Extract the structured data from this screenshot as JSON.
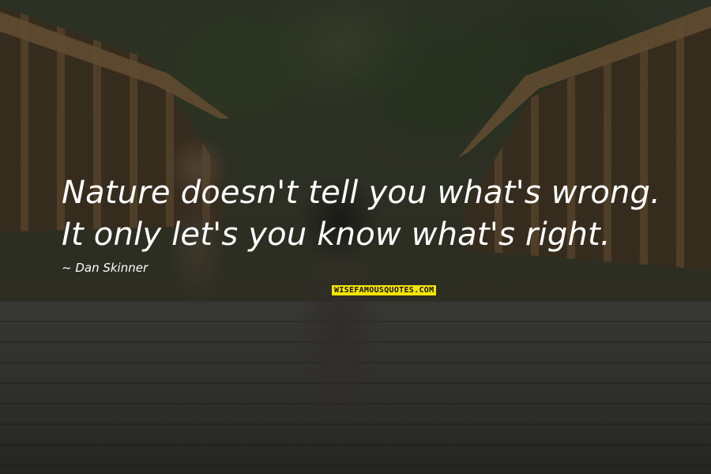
{
  "quote": {
    "text": "Nature doesn't tell you what's wrong. It only let's you know what's right.",
    "author": "~ Dan Skinner"
  },
  "watermark": {
    "text": "WISEFAMOUSQUOTES.COM",
    "bg_color": "#f4e400"
  },
  "photo": {
    "overlay_color": "#000000"
  }
}
